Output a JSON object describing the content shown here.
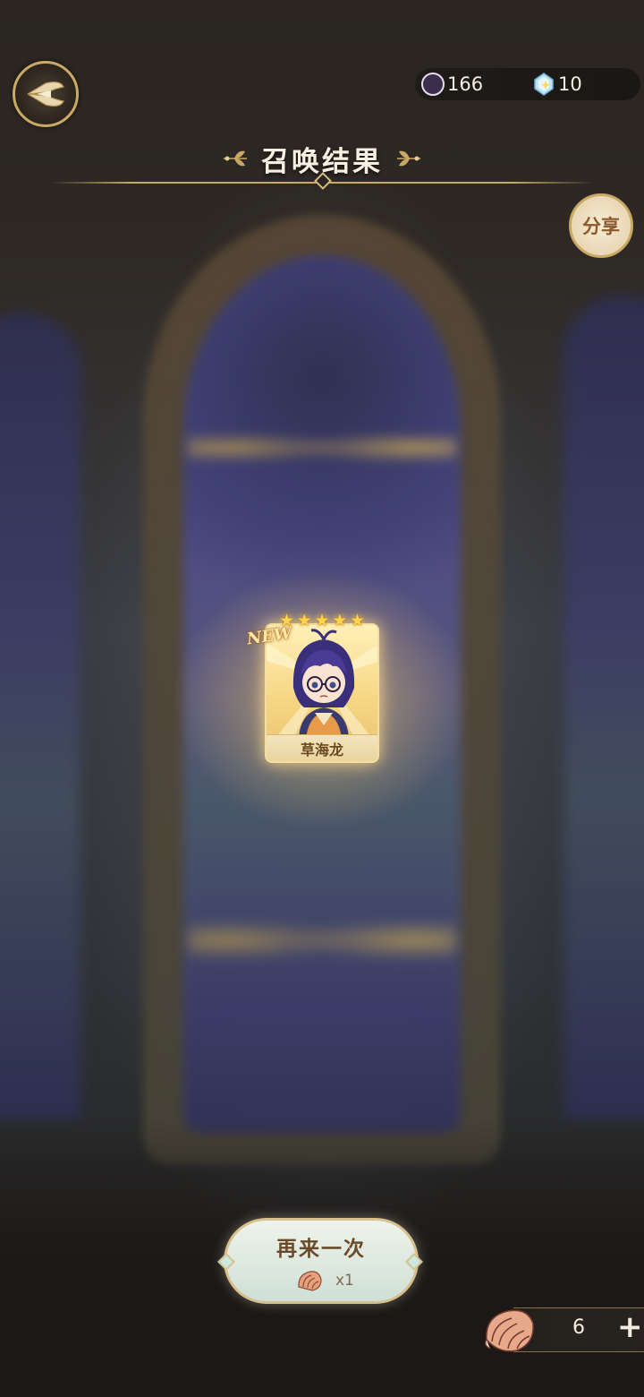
{
  "currencies": {
    "moon": {
      "icon": "crescent-moon-icon",
      "value": "166"
    },
    "crystal": {
      "icon": "crystal-icon",
      "value": "10"
    }
  },
  "header": {
    "title": "召唤结果"
  },
  "share": {
    "label": "分享"
  },
  "result_card": {
    "name": "草海龙",
    "badge": "NEW",
    "stars": 5,
    "star_glyph": "★"
  },
  "summon_again": {
    "label": "再来一次",
    "cost_icon": "shell-icon",
    "cost": "x1"
  },
  "shell_balance": {
    "icon": "conch-shell-icon",
    "count": "6",
    "add_label": "+"
  },
  "colors": {
    "gold": "#c9a964",
    "card_gold": "#f6d683",
    "button_mint": "#cfe0d6",
    "stained_glass_blue": "#3d3f7a"
  }
}
